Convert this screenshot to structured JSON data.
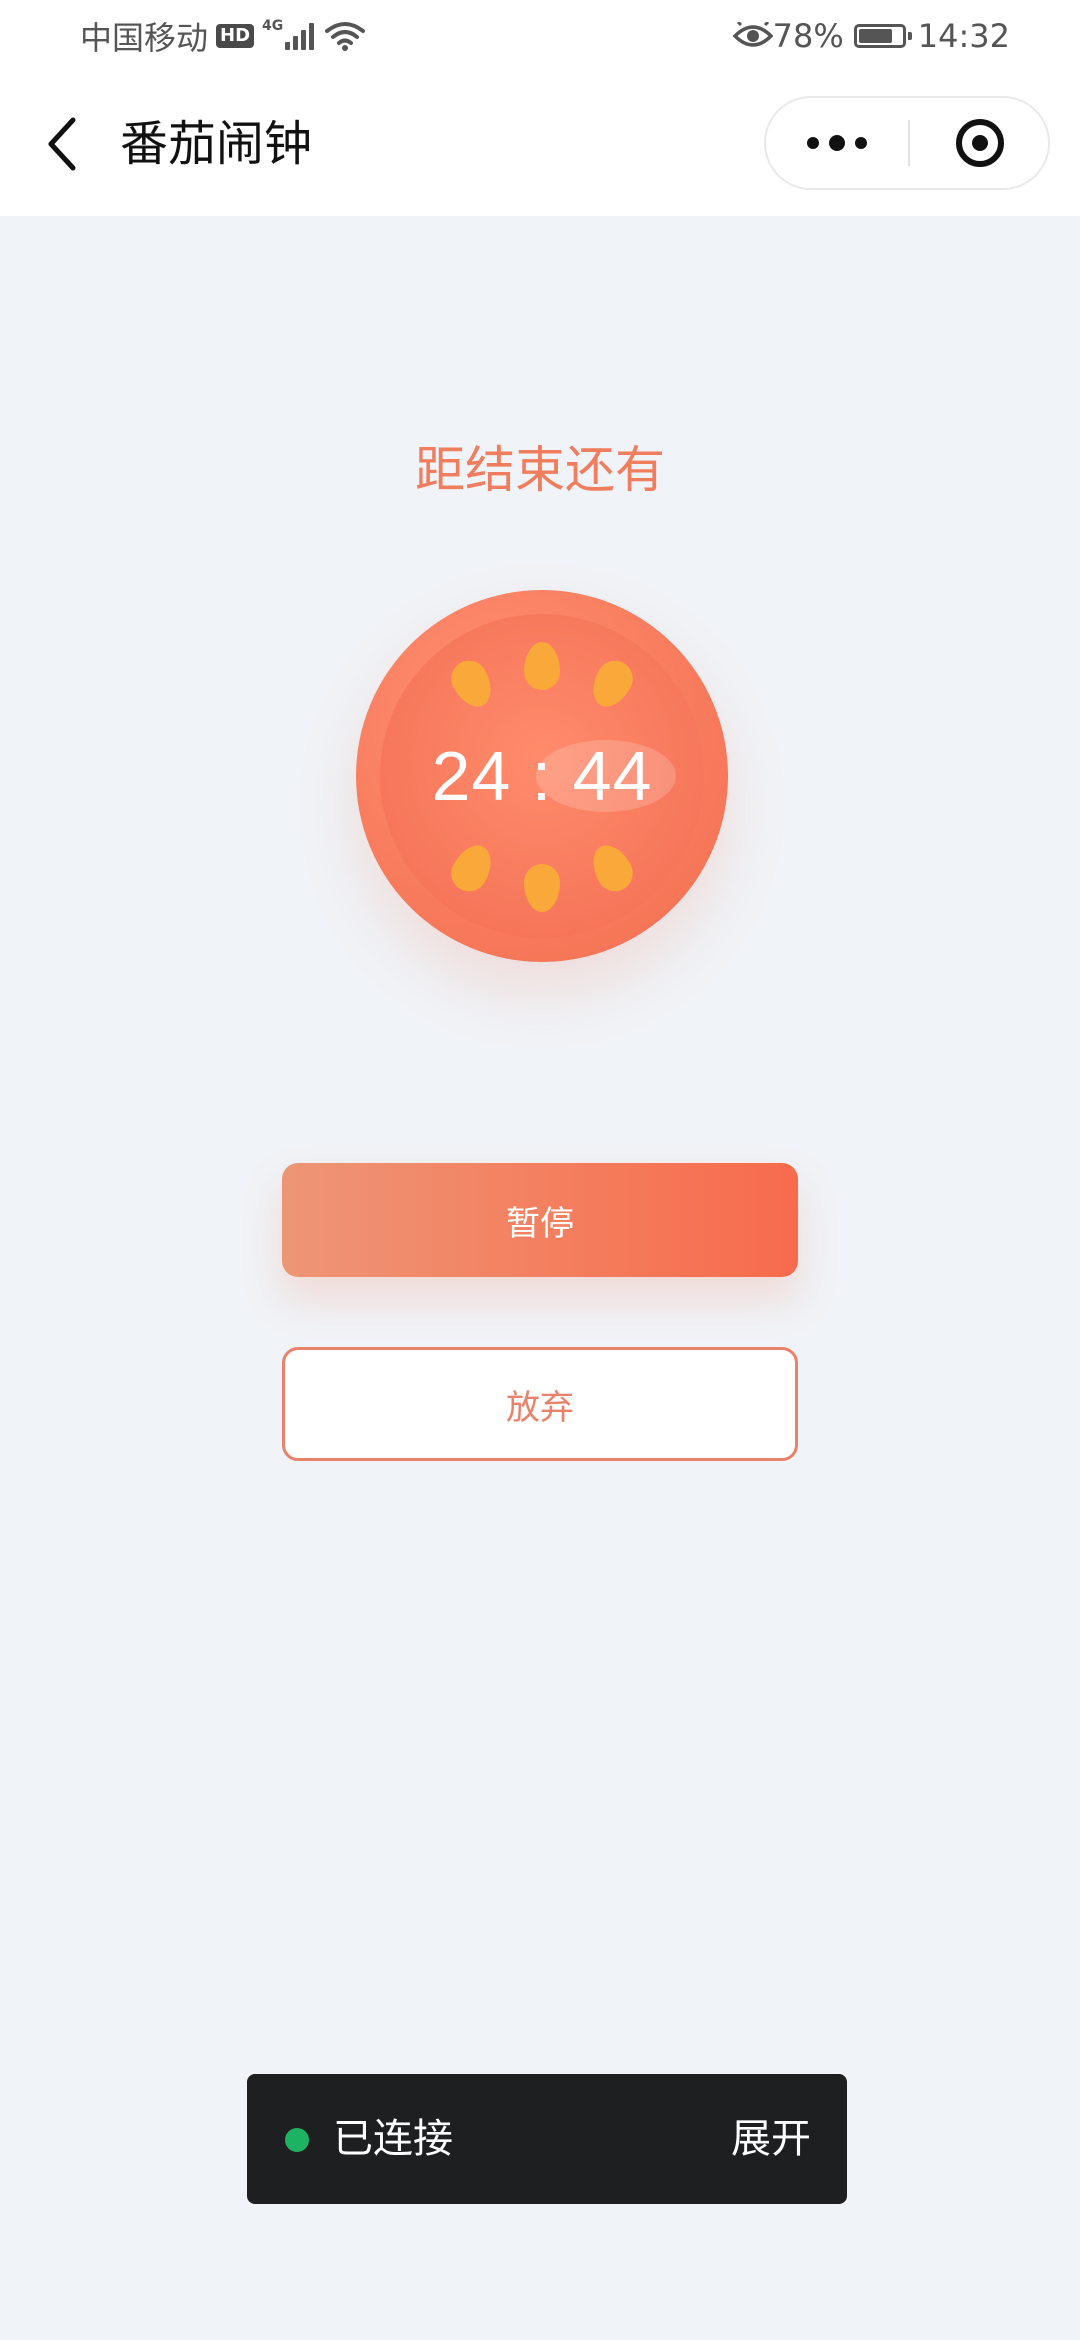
{
  "status_bar": {
    "carrier": "中国移动",
    "hd_badge": "HD",
    "network_type": "4G",
    "signal_level": 4,
    "battery_text": "78%",
    "battery_level": 0.78,
    "time": "14:32",
    "icons": [
      "hd-icon",
      "signal-icon",
      "wifi-icon",
      "eye-icon",
      "battery-icon"
    ]
  },
  "nav": {
    "title": "番茄闹钟",
    "back_icon": "chevron-left-icon",
    "more_icon": "more-dots-icon",
    "close_icon": "target-circle-icon"
  },
  "timer": {
    "label": "距结束还有",
    "time": "24 : 44"
  },
  "actions": {
    "pause_label": "暂停",
    "abandon_label": "放弃"
  },
  "connection": {
    "status": "已连接",
    "expand_label": "展开"
  },
  "colors": {
    "background": "#F0F3F7",
    "accent": "#F07D5E",
    "tomato": "#F87A5C",
    "seed": "#F9A83A",
    "toast_bg": "#1E1F21",
    "connected_dot": "#1DB362"
  }
}
